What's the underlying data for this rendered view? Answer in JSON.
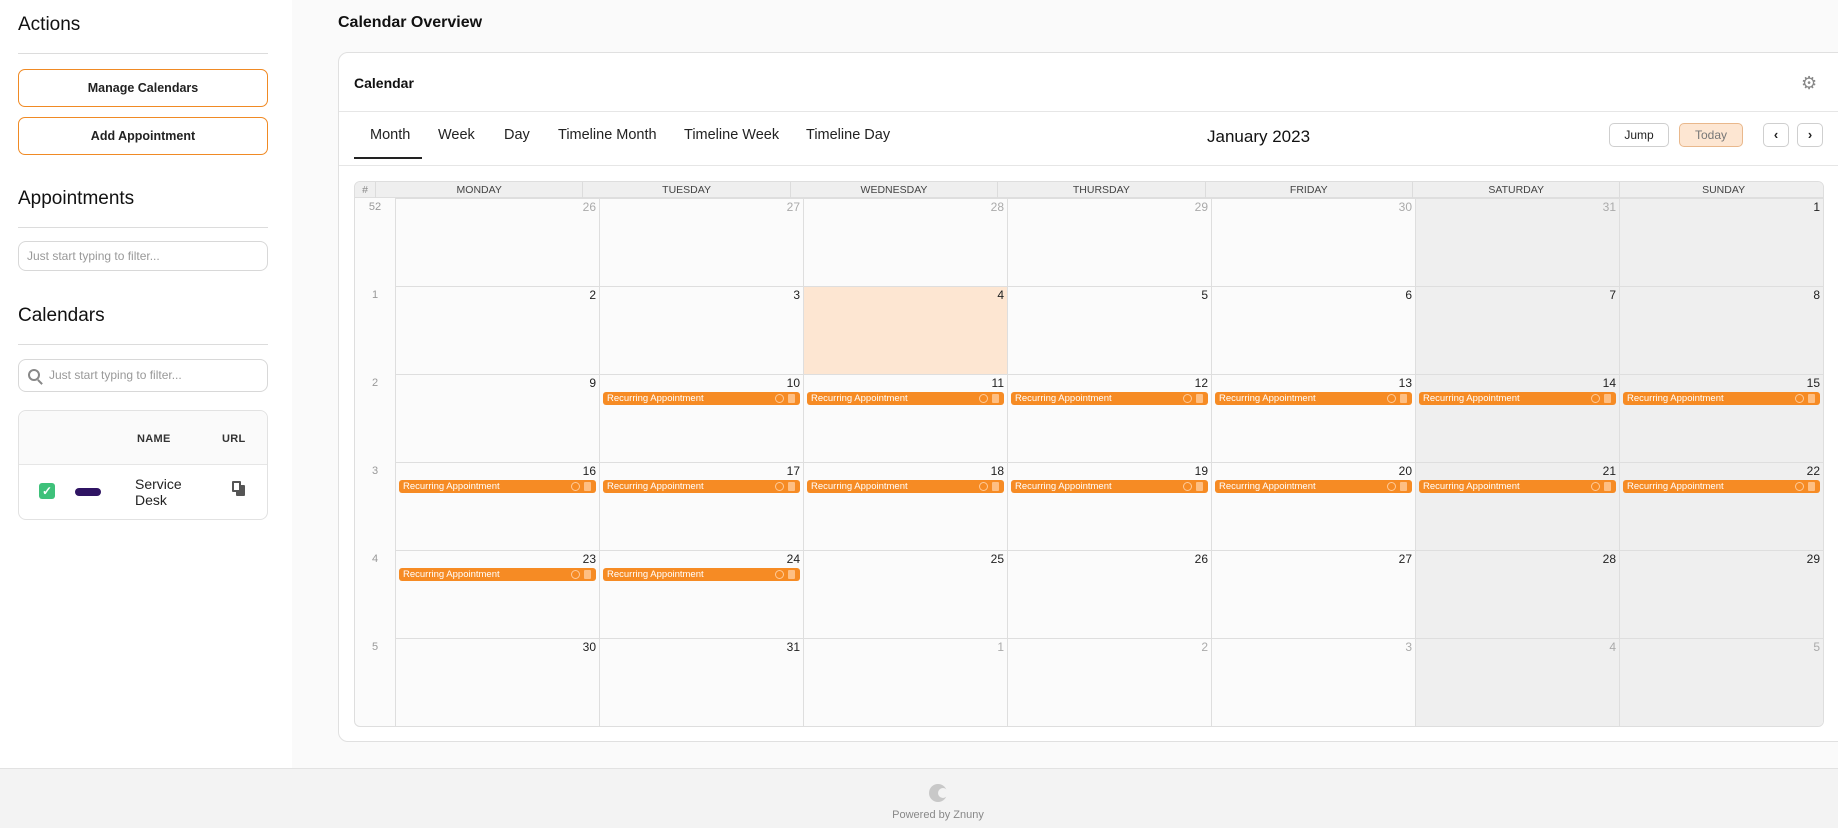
{
  "sidebar": {
    "actions_heading": "Actions",
    "manage_calendars": "Manage Calendars",
    "add_appointment": "Add Appointment",
    "appointments_heading": "Appointments",
    "appointments_filter_placeholder": "Just start typing to filter...",
    "calendars_heading": "Calendars",
    "calendars_filter_placeholder": "Just start typing to filter...",
    "table": {
      "col_name": "NAME",
      "col_url": "URL",
      "row": {
        "name": "Service Desk",
        "color": "#2f1463",
        "checked": true,
        "url_icon": "copy-icon"
      }
    }
  },
  "main": {
    "page_title": "Calendar Overview",
    "card_title": "Calendar",
    "settings_icon": "gear-icon",
    "tabs": [
      "Month",
      "Week",
      "Day",
      "Timeline Month",
      "Timeline Week",
      "Timeline Day"
    ],
    "active_tab": "Month",
    "month_title": "January 2023",
    "jump": "Jump",
    "today": "Today",
    "prev_icon": "chevron-left-icon",
    "next_icon": "chevron-right-icon"
  },
  "calendar": {
    "hash": "#",
    "days": [
      "MONDAY",
      "TUESDAY",
      "WEDNESDAY",
      "THURSDAY",
      "FRIDAY",
      "SATURDAY",
      "SUNDAY"
    ],
    "weeks": [
      {
        "num": "52",
        "dates": [
          "26",
          "27",
          "28",
          "29",
          "30",
          "31",
          "1"
        ],
        "other": [
          true,
          true,
          true,
          true,
          true,
          true,
          false
        ],
        "events": [
          false,
          false,
          false,
          false,
          false,
          false,
          false
        ]
      },
      {
        "num": "1",
        "dates": [
          "2",
          "3",
          "4",
          "5",
          "6",
          "7",
          "8"
        ],
        "other": [
          false,
          false,
          false,
          false,
          false,
          false,
          false
        ],
        "events": [
          false,
          false,
          false,
          false,
          false,
          false,
          false
        ]
      },
      {
        "num": "2",
        "dates": [
          "9",
          "10",
          "11",
          "12",
          "13",
          "14",
          "15"
        ],
        "other": [
          false,
          false,
          false,
          false,
          false,
          false,
          false
        ],
        "events": [
          false,
          true,
          true,
          true,
          true,
          true,
          true
        ]
      },
      {
        "num": "3",
        "dates": [
          "16",
          "17",
          "18",
          "19",
          "20",
          "21",
          "22"
        ],
        "other": [
          false,
          false,
          false,
          false,
          false,
          false,
          false
        ],
        "events": [
          true,
          true,
          true,
          true,
          true,
          true,
          true
        ]
      },
      {
        "num": "4",
        "dates": [
          "23",
          "24",
          "25",
          "26",
          "27",
          "28",
          "29"
        ],
        "other": [
          false,
          false,
          false,
          false,
          false,
          false,
          false
        ],
        "events": [
          true,
          true,
          false,
          false,
          false,
          false,
          false
        ]
      },
      {
        "num": "5",
        "dates": [
          "30",
          "31",
          "1",
          "2",
          "3",
          "4",
          "5"
        ],
        "other": [
          false,
          false,
          true,
          true,
          true,
          true,
          true
        ],
        "events": [
          false,
          false,
          false,
          false,
          false,
          false,
          false
        ]
      }
    ],
    "today_date": "4",
    "event_title": "Recurring Appointment",
    "event_color": "#f68b24",
    "today_color": "#fde6d2"
  },
  "footer": {
    "text": "Powered by Znuny"
  }
}
